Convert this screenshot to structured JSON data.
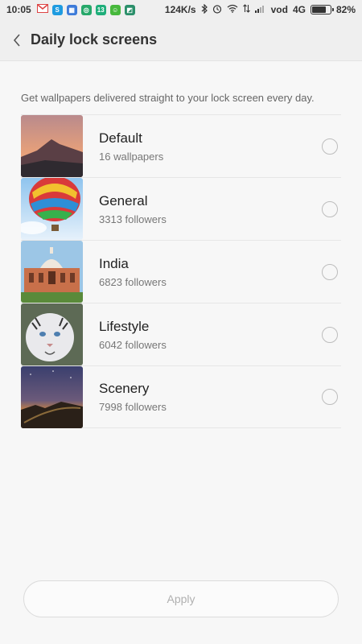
{
  "status_bar": {
    "time": "10:05",
    "network_speed": "124K/s",
    "carrier": "vod",
    "network_type": "4G",
    "battery_percent": "82%",
    "battery_level": 0.82,
    "notification_icons": [
      "gmail-icon",
      "skype-icon",
      "calendar-icon",
      "shield-app-icon",
      "calendar-13-icon",
      "wechat-icon",
      "green-app-icon"
    ],
    "system_icons": [
      "bluetooth-icon",
      "alarm-icon",
      "wifi-icon",
      "data-arrows-icon",
      "signal-icon"
    ]
  },
  "header": {
    "back_icon": "chevron-left-icon",
    "title": "Daily lock screens"
  },
  "description": "Get wallpapers delivered straight to your lock screen every day.",
  "items": [
    {
      "title": "Default",
      "subtitle": "16 wallpapers",
      "thumbnail": "mountain-sunset",
      "selected": false
    },
    {
      "title": "General",
      "subtitle": "3313 followers",
      "thumbnail": "hot-air-balloon",
      "selected": false
    },
    {
      "title": "India",
      "subtitle": "6823 followers",
      "thumbnail": "indian-monument",
      "selected": false
    },
    {
      "title": "Lifestyle",
      "subtitle": "6042 followers",
      "thumbnail": "white-tiger",
      "selected": false
    },
    {
      "title": "Scenery",
      "subtitle": "7998 followers",
      "thumbnail": "great-wall-night",
      "selected": false
    }
  ],
  "apply_label": "Apply",
  "colors": {
    "background": "#f7f7f7",
    "header_background": "#efefef",
    "radio_border": "#bdbdbd",
    "apply_text": "#b0b0b0"
  }
}
